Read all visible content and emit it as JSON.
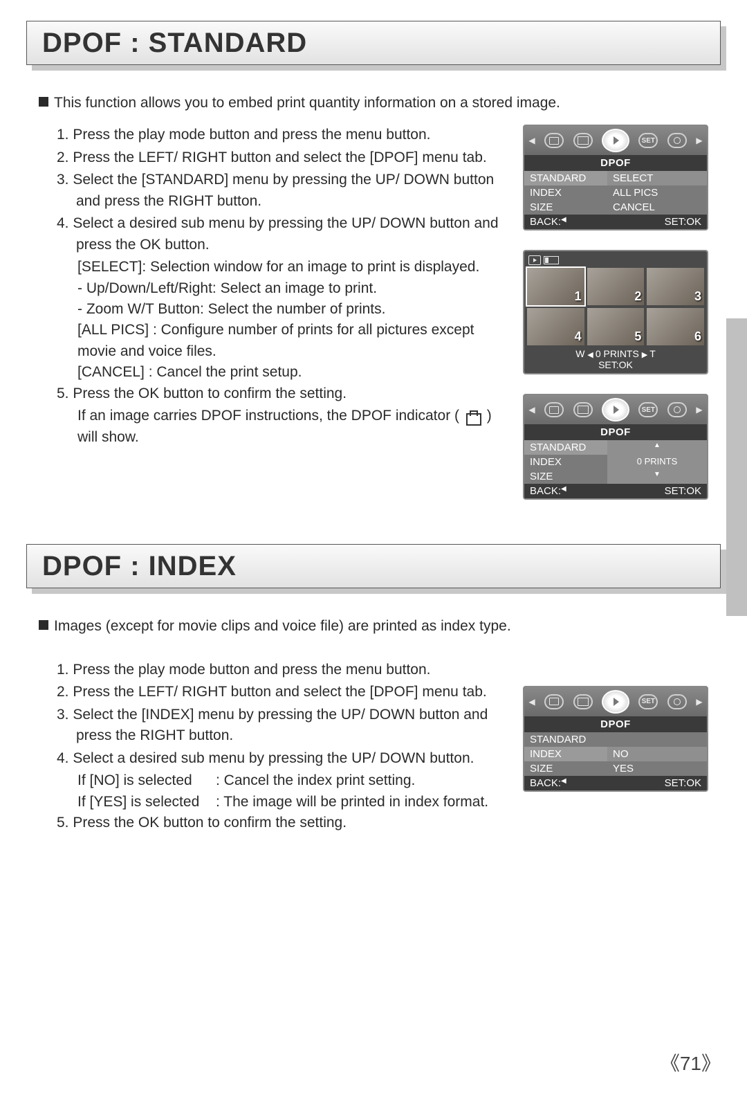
{
  "page_number": "71",
  "section1": {
    "heading": "DPOF : STANDARD",
    "intro": "This function allows you to embed print quantity information on a stored image.",
    "steps": {
      "s1": "1. Press the play mode button and press the menu button.",
      "s2": "2. Press the LEFT/ RIGHT button and select the [DPOF] menu tab.",
      "s3": "3. Select the [STANDARD] menu by pressing the UP/ DOWN button and press the RIGHT button.",
      "s4": "4. Select a desired sub menu by pressing the UP/ DOWN button and press the OK button.",
      "s4a": "[SELECT]: Selection window for an image to print is displayed.",
      "s4b": "- Up/Down/Left/Right: Select an image to print.",
      "s4c": "- Zoom W/T Button: Select the number of prints.",
      "s4d": "[ALL PICS] : Configure number of prints for all pictures except movie and voice files.",
      "s4e": "[CANCEL] : Cancel the print setup.",
      "s5a": "5. Press the OK button to confirm the setting.",
      "s5b": "If an image carries DPOF instructions, the DPOF indicator (",
      "s5c": ") will show."
    }
  },
  "section2": {
    "heading": "DPOF : INDEX",
    "intro": "Images (except for movie clips and voice file) are printed as index type.",
    "steps": {
      "s1": "1. Press the play mode button and press the menu button.",
      "s2": "2. Press the LEFT/ RIGHT button and select the [DPOF] menu tab.",
      "s3": "3. Select the [INDEX] menu by pressing the UP/ DOWN button and press the RIGHT button.",
      "s4": "4. Select a desired sub menu by pressing the UP/ DOWN button.",
      "s4a": "If [NO] is selected",
      "s4a2": ": Cancel the index print setting.",
      "s4b": "If [YES] is selected",
      "s4b2": ": The image will be printed in index format.",
      "s5": "5. Press the OK button to confirm the setting."
    }
  },
  "lcd": {
    "tab_set": "SET",
    "menu_title": "DPOF",
    "standard": "STANDARD",
    "index": "INDEX",
    "size": "SIZE",
    "select": "SELECT",
    "allpics": "ALL PICS",
    "cancel": "CANCEL",
    "no": "NO",
    "yes": "YES",
    "back": "BACK:",
    "setok": "SET:OK",
    "zero_prints": "0 PRINTS",
    "w": "W",
    "t": "T",
    "thumbs": [
      "1",
      "2",
      "3",
      "4",
      "5",
      "6"
    ]
  }
}
